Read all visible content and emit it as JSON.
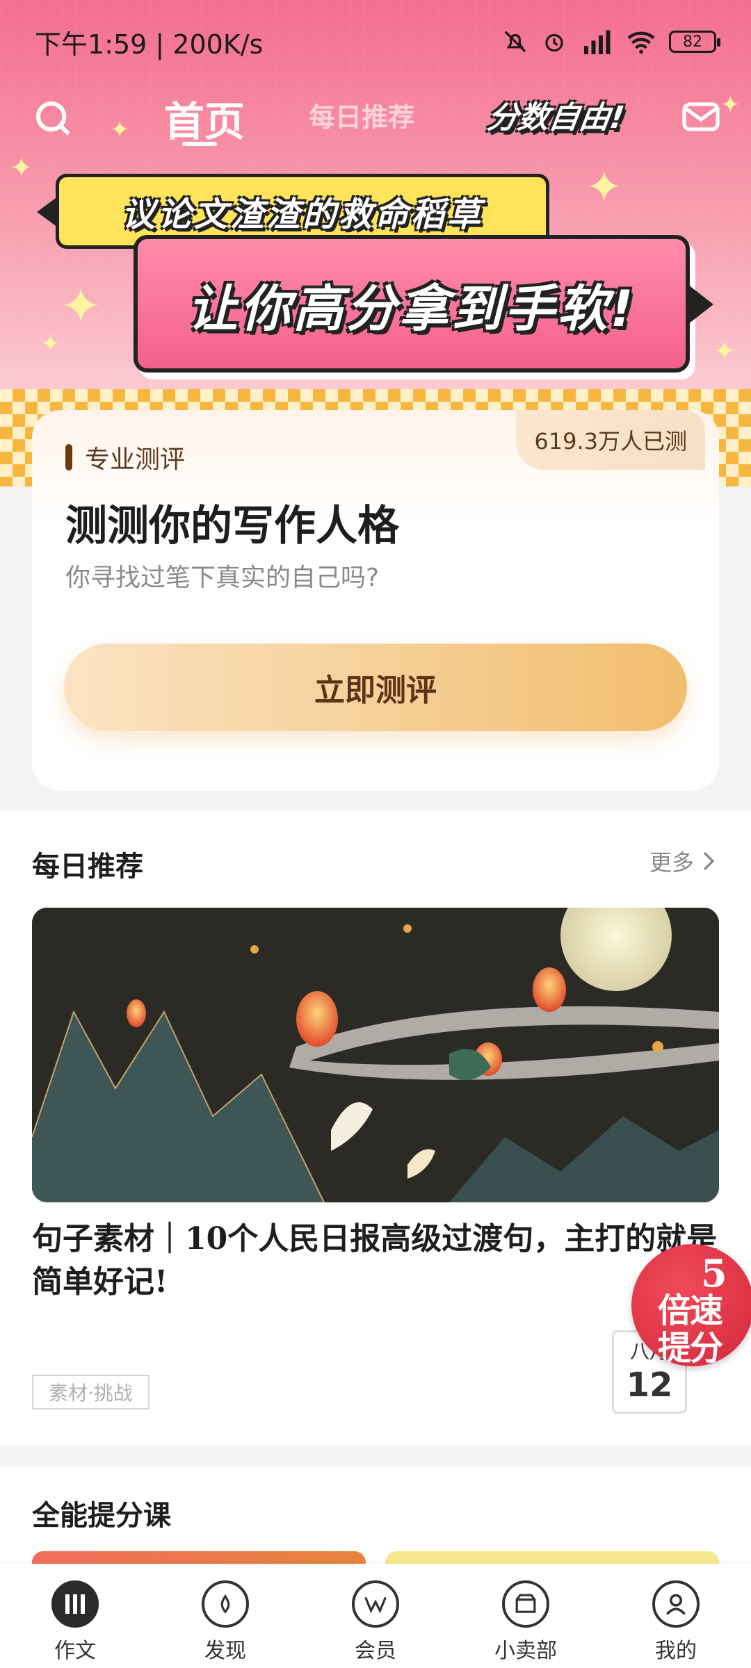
{
  "status_bar": {
    "time_speed": "下午1:59 | 200K/s",
    "battery": "82"
  },
  "top_nav": {
    "home_label": "首页",
    "daily_label": "每日推荐",
    "logo_text": "分数自由!"
  },
  "banner": {
    "line1": "议论文渣渣的救命稻草",
    "line2": "让你高分拿到手软!"
  },
  "test_card": {
    "count": "619.3万人已测",
    "tag": "专业测评",
    "title": "测测你的写作人格",
    "subtitle": "你寻找过笔下真实的自己吗?",
    "button": "立即测评"
  },
  "daily": {
    "title": "每日推荐",
    "more": "更多",
    "article_title": "句子素材｜10个人民日报高级过渡句，主打的就是简单好记!",
    "tag": "素材·挑战",
    "date_month": "八月",
    "date_day": "12"
  },
  "badge": {
    "num": "5",
    "line1": "倍速",
    "line2": "提分"
  },
  "courses": {
    "title": "全能提分课"
  },
  "bottom_nav": {
    "tabs": [
      {
        "label": "作文",
        "icon": "essay-icon",
        "active": true
      },
      {
        "label": "发现",
        "icon": "discover-icon"
      },
      {
        "label": "会员",
        "icon": "vip-icon"
      },
      {
        "label": "小卖部",
        "icon": "shop-icon"
      },
      {
        "label": "我的",
        "icon": "profile-icon"
      }
    ]
  },
  "colors": {
    "accent_pink": "#f46d8f",
    "button_gold": "#f1bd6e",
    "badge_red": "#d4283b"
  }
}
